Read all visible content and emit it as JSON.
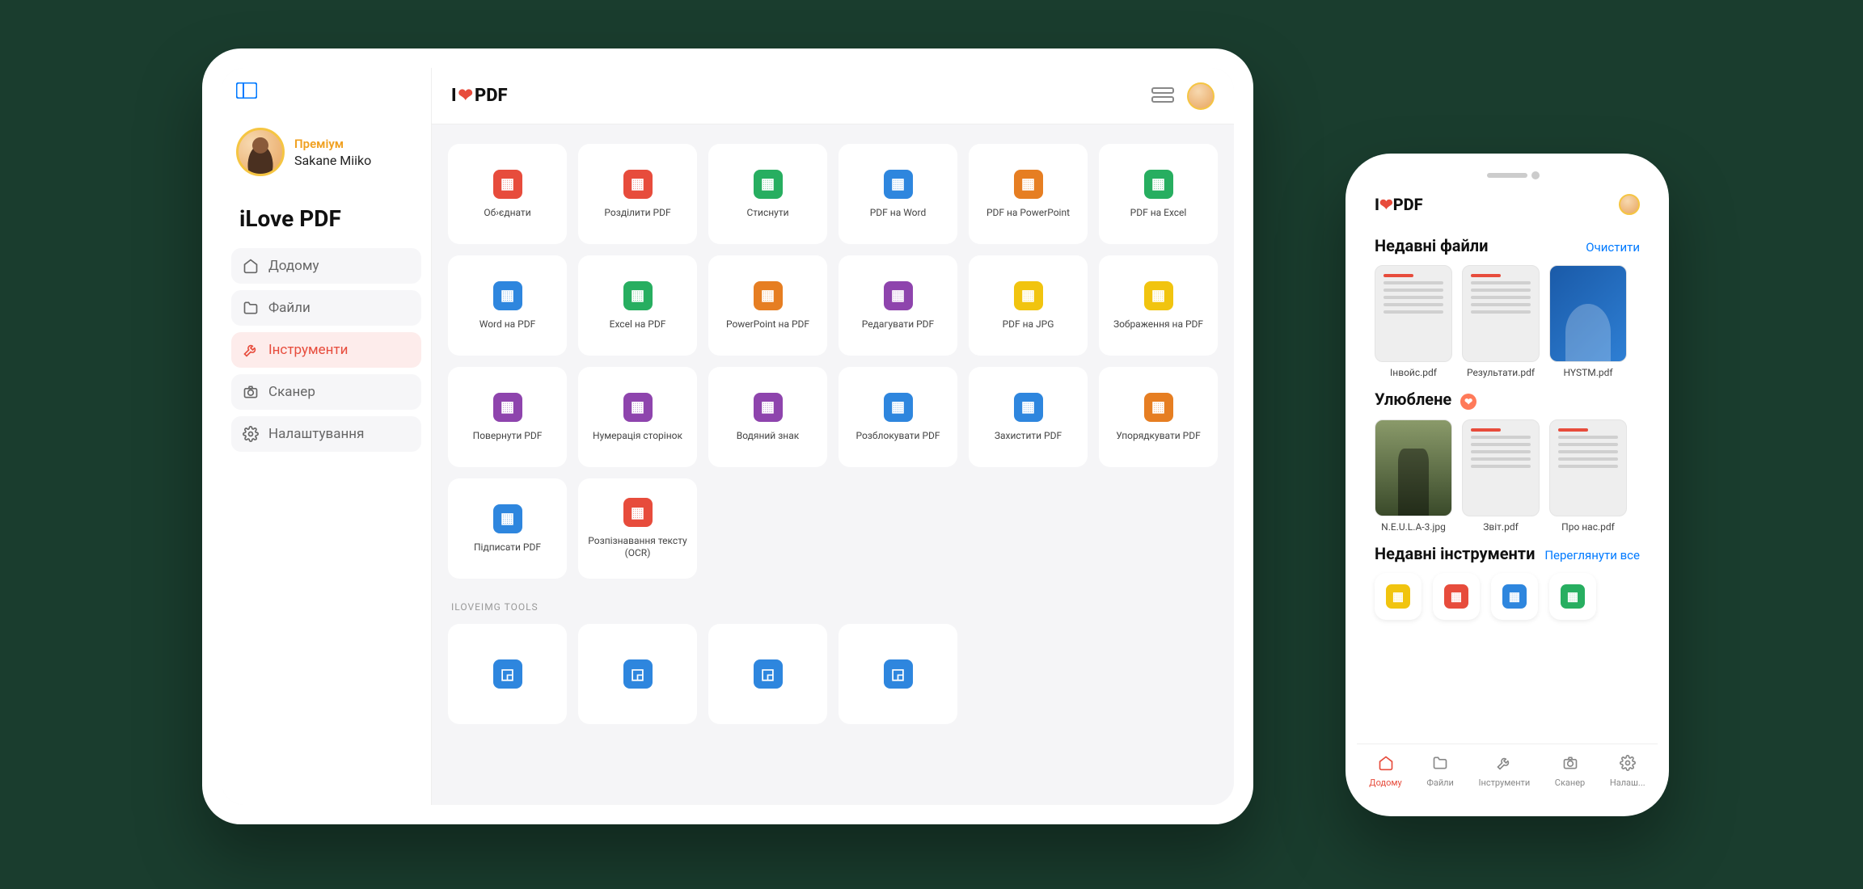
{
  "tablet": {
    "sidebar": {
      "badge": "Преміум",
      "username": "Sakane Miiko",
      "app_title": "iLove PDF",
      "nav": [
        {
          "label": "Додому",
          "icon": "home"
        },
        {
          "label": "Файли",
          "icon": "folder"
        },
        {
          "label": "Інструменти",
          "icon": "wrench",
          "active": true
        },
        {
          "label": "Сканер",
          "icon": "camera"
        },
        {
          "label": "Налаштування",
          "icon": "gear"
        }
      ]
    },
    "logo_text": "I❤PDF",
    "tools": [
      {
        "label": "Об›єднати",
        "color": "#e74c3c"
      },
      {
        "label": "Розділити PDF",
        "color": "#e74c3c"
      },
      {
        "label": "Стиснути",
        "color": "#27ae60"
      },
      {
        "label": "PDF на Word",
        "color": "#2e86de"
      },
      {
        "label": "PDF на PowerPoint",
        "color": "#e67e22"
      },
      {
        "label": "PDF на Excel",
        "color": "#27ae60"
      },
      {
        "label": "Word на PDF",
        "color": "#2e86de"
      },
      {
        "label": "Excel на PDF",
        "color": "#27ae60"
      },
      {
        "label": "PowerPoint на PDF",
        "color": "#e67e22"
      },
      {
        "label": "Редагувати PDF",
        "color": "#8e44ad"
      },
      {
        "label": "PDF на JPG",
        "color": "#f1c40f"
      },
      {
        "label": "Зображення на PDF",
        "color": "#f1c40f"
      },
      {
        "label": "Повернути PDF",
        "color": "#8e44ad"
      },
      {
        "label": "Нумерація сторінок",
        "color": "#8e44ad"
      },
      {
        "label": "Водяний знак",
        "color": "#8e44ad"
      },
      {
        "label": "Розблокувати PDF",
        "color": "#2e86de"
      },
      {
        "label": "Захистити PDF",
        "color": "#2e86de"
      },
      {
        "label": "Упорядкувати PDF",
        "color": "#e67e22"
      },
      {
        "label": "Підписати PDF",
        "color": "#2e86de"
      },
      {
        "label": "Розпізнавання тексту (OCR)",
        "color": "#e74c3c"
      }
    ],
    "section2_label": "ILOVEIMG TOOLS",
    "img_tools": [
      {
        "color": "#2e86de"
      },
      {
        "color": "#2e86de"
      },
      {
        "color": "#2e86de"
      },
      {
        "color": "#2e86de"
      }
    ]
  },
  "phone": {
    "logo_text": "I❤PDF",
    "recent_files": {
      "title": "Недавні файли",
      "action": "Очистити",
      "items": [
        {
          "label": "Інвойс.pdf",
          "kind": "doc"
        },
        {
          "label": "Результати.pdf",
          "kind": "doc"
        },
        {
          "label": "HYSTM.pdf",
          "kind": "poster"
        }
      ]
    },
    "favorites": {
      "title": "Улюблене",
      "items": [
        {
          "label": "N.E.U.L.A-3.jpg",
          "kind": "photo"
        },
        {
          "label": "Звіт.pdf",
          "kind": "doc"
        },
        {
          "label": "Про нас.pdf",
          "kind": "doc"
        }
      ]
    },
    "recent_tools": {
      "title": "Недавні інструменти",
      "action": "Переглянути все",
      "items": [
        {
          "color": "#f1c40f"
        },
        {
          "color": "#e74c3c"
        },
        {
          "color": "#2e86de"
        },
        {
          "color": "#27ae60"
        }
      ]
    },
    "tabs": [
      {
        "label": "Додому",
        "icon": "home",
        "active": true
      },
      {
        "label": "Файли",
        "icon": "folder"
      },
      {
        "label": "Інструменти",
        "icon": "wrench"
      },
      {
        "label": "Сканер",
        "icon": "camera"
      },
      {
        "label": "Налаш...",
        "icon": "gear"
      }
    ]
  }
}
